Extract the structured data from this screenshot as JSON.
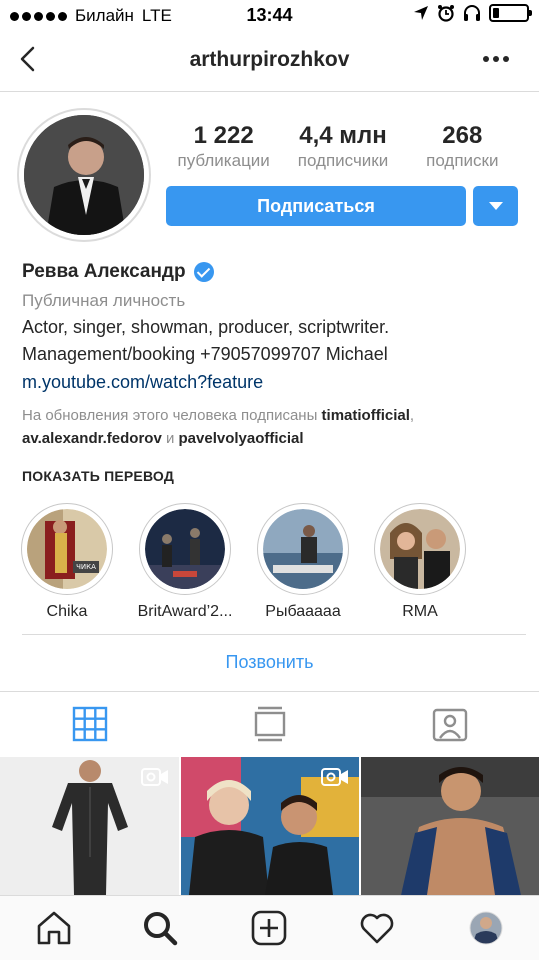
{
  "status_bar": {
    "carrier": "Билайн",
    "network": "LTE",
    "time": "13:44",
    "battery_level": 0.2
  },
  "header": {
    "username": "arthurpirozhkov",
    "back_icon": "chevron-left-icon",
    "more_icon": "more-horizontal-icon"
  },
  "profile": {
    "stats": [
      {
        "value": "1 222",
        "label": "публикации"
      },
      {
        "value": "4,4 млн",
        "label": "подписчики"
      },
      {
        "value": "268",
        "label": "подписки"
      }
    ],
    "follow_label": "Подписаться",
    "name": "Ревва Александр",
    "category": "Публичная личность",
    "bio_line1": "Actor, singer, showman, producer, scriptwriter.",
    "bio_line2": "Management/booking +79057099707 Michael",
    "link": "m.youtube.com/watch?feature",
    "followed_by_prefix": "На обновления этого человека подписаны ",
    "followed_user1": "timatiofficial",
    "followed_sep1": ",",
    "followed_user2": "av.alexandr.fedorov",
    "followed_and": " и ",
    "followed_user3": "pavelvolyaofficial",
    "show_translation": "ПОКАЗАТЬ ПЕРЕВОД"
  },
  "highlights": [
    {
      "label": "Chika",
      "overlay_text": "ЧИКА"
    },
    {
      "label": "BritAward’2..."
    },
    {
      "label": "Рыбааааа"
    },
    {
      "label": "RMA"
    }
  ],
  "contact": {
    "call_label": "Позвонить"
  },
  "tabs": [
    {
      "name": "grid-icon",
      "active": true
    },
    {
      "name": "feed-icon",
      "active": false
    },
    {
      "name": "tagged-icon",
      "active": false
    }
  ],
  "bottom_nav": [
    "home-icon",
    "search-icon",
    "add-post-icon",
    "heart-icon",
    "profile-avatar"
  ],
  "colors": {
    "accent": "#3897f0",
    "text": "#262626",
    "secondary": "#8e8e8e",
    "link": "#003569",
    "divider": "#dbdbdb"
  }
}
